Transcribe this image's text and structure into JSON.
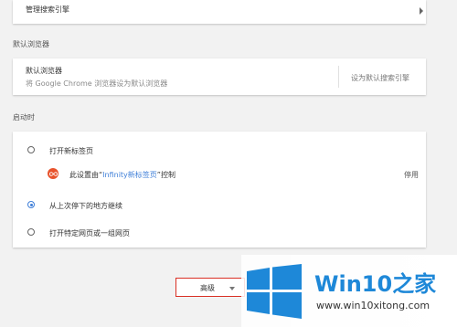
{
  "search_engine_card": {
    "manage_label": "管理搜索引擎"
  },
  "default_browser": {
    "section_title": "默认浏览器",
    "title": "默认浏览器",
    "description": "将 Google Chrome 浏览器设为默认浏览器",
    "set_default_button": "设为默认搜索引擎"
  },
  "startup": {
    "section_title": "启动时",
    "options": [
      {
        "label": "打开新标签页",
        "checked": false
      },
      {
        "label": "从上次停下的地方继续",
        "checked": true
      },
      {
        "label": "打开特定网页或一组网页",
        "checked": false
      }
    ],
    "extension_notice": {
      "prefix": "此设置由“",
      "extension_name": "Infinity新标签页",
      "suffix": "”控制",
      "disable_label": "停用"
    }
  },
  "advanced": {
    "label": "高级"
  },
  "watermark": {
    "brand": "Win10",
    "brand_suffix": "之家",
    "url": "www.win10xitong.com"
  },
  "colors": {
    "accent_blue": "#3f7fd8",
    "highlight_red": "#d93025",
    "ext_icon": "#e8532c",
    "win_blue": "#1e88d8"
  }
}
